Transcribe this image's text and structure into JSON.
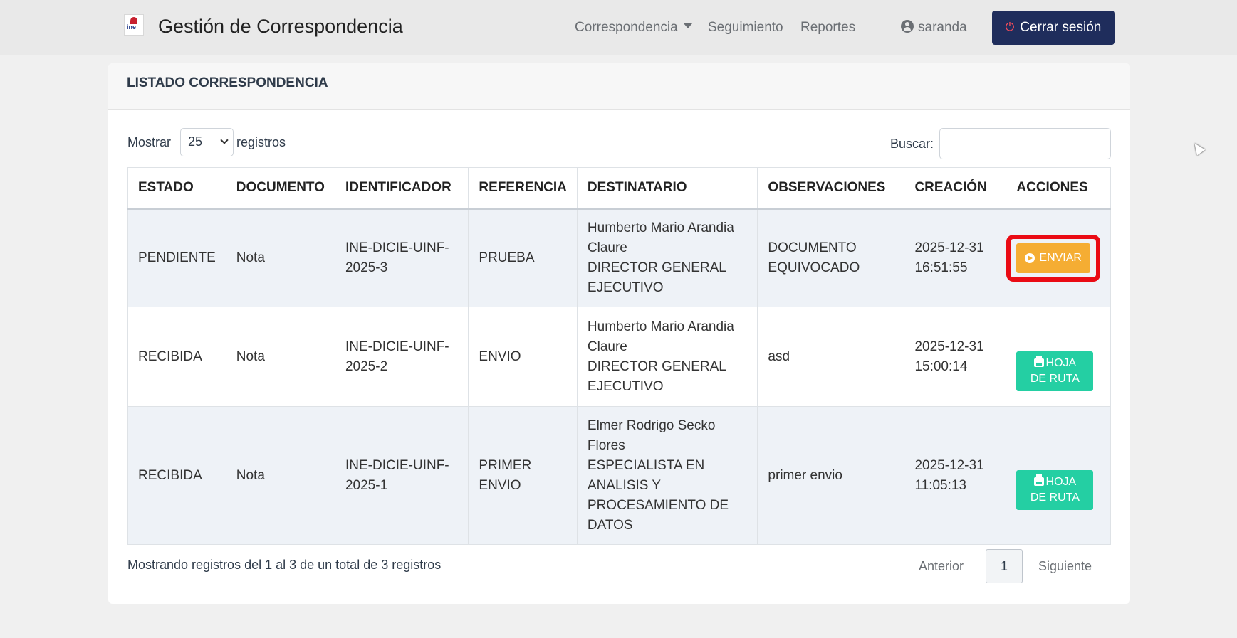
{
  "navbar": {
    "logo_text": "ine",
    "title": "Gestión de Correspondencia",
    "menu": [
      {
        "label": "Correspondencia"
      },
      {
        "label": "Seguimiento"
      },
      {
        "label": "Reportes"
      }
    ],
    "user": "saranda",
    "logout_label": "Cerrar sesión"
  },
  "card": {
    "title": "LISTADO CORRESPONDENCIA",
    "length_label": "Mostrar",
    "length_value": "25",
    "length_suffix": "registros",
    "search_label": "Buscar:",
    "search_value": ""
  },
  "table": {
    "headers": [
      "ESTADO",
      "DOCUMENTO",
      "IDENTIFICADOR",
      "REFERENCIA",
      "DESTINATARIO",
      "OBSERVACIONES",
      "CREACIÓN",
      "ACCIONES"
    ],
    "rows": [
      {
        "estado": "PENDIENTE",
        "documento": "Nota",
        "identificador": [
          "INE-DICIE-UINF-",
          "2025-3"
        ],
        "referencia": [
          "PRUEBA"
        ],
        "destinatario": [
          "Humberto Mario Arandia",
          "Claure",
          "DIRECTOR GENERAL",
          "EJECUTIVO"
        ],
        "observaciones": [
          "DOCUMENTO",
          "EQUIVOCADO"
        ],
        "creacion": [
          "2025-12-31",
          "16:51:55"
        ],
        "accion": "ENVIAR"
      },
      {
        "estado": "RECIBIDA",
        "documento": "Nota",
        "identificador": [
          "INE-DICIE-UINF-",
          "2025-2"
        ],
        "referencia": [
          "ENVIO"
        ],
        "destinatario": [
          "Humberto Mario Arandia",
          "Claure",
          "DIRECTOR GENERAL",
          "EJECUTIVO"
        ],
        "observaciones": [
          "asd"
        ],
        "creacion": [
          "2025-12-31",
          "15:00:14"
        ],
        "accion": [
          "HOJA",
          "DE RUTA"
        ]
      },
      {
        "estado": "RECIBIDA",
        "documento": "Nota",
        "identificador": [
          "INE-DICIE-UINF-",
          "2025-1"
        ],
        "referencia": [
          "PRIMER",
          "ENVIO"
        ],
        "destinatario": [
          "Elmer Rodrigo Secko",
          "Flores",
          "ESPECIALISTA EN",
          "ANALISIS Y",
          "PROCESAMIENTO DE",
          "DATOS"
        ],
        "observaciones": [
          "primer envio"
        ],
        "creacion": [
          "2025-12-31",
          "11:05:13"
        ],
        "accion": [
          "HOJA",
          "DE RUTA"
        ]
      }
    ]
  },
  "footer": {
    "info": "Mostrando registros del 1 al 3 de un total de 3 registros",
    "prev": "Anterior",
    "page": "1",
    "next": "Siguiente"
  },
  "colors": {
    "logout_bg": "#1f2d5c",
    "enviar_bg": "#f5ad33",
    "hoja_bg": "#24cfa3",
    "highlight": "#ea0b14"
  }
}
